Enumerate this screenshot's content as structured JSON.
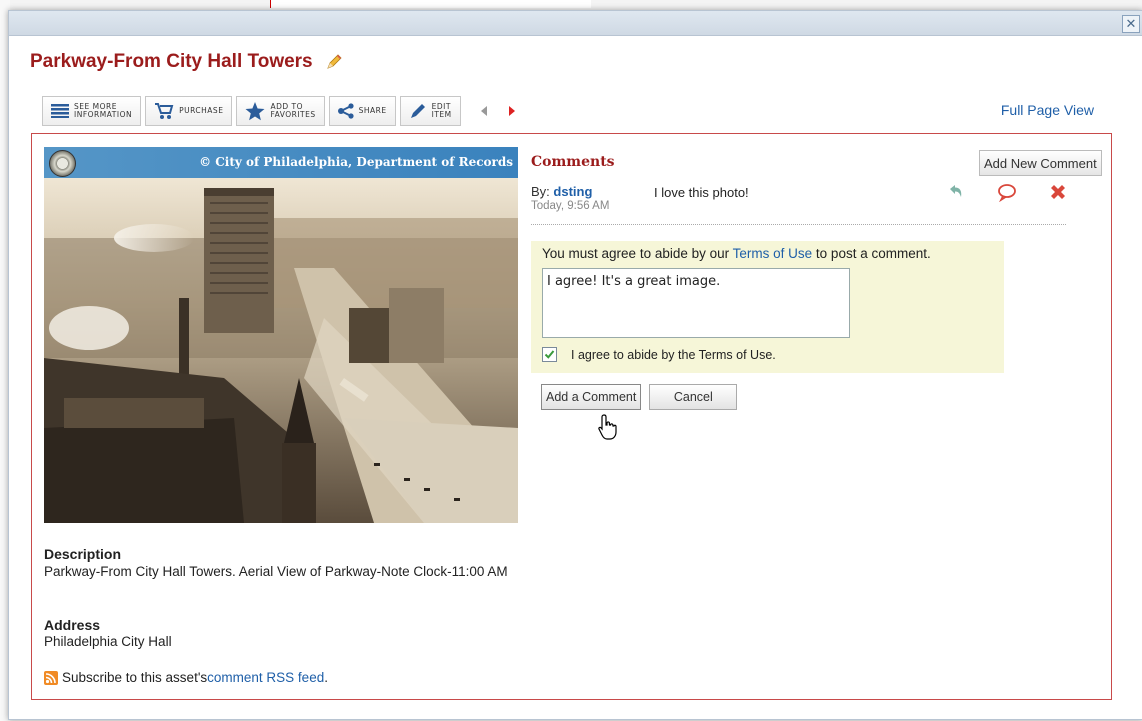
{
  "modal": {
    "close_glyph": "✕",
    "title": "Parkway-From City Hall Towers",
    "full_page_view": "Full Page View"
  },
  "toolbar": {
    "see_more": "SEE MORE\nINFORMATION",
    "purchase": "PURCHASE",
    "favorites": "ADD TO\nFAVORITES",
    "share": "SHARE",
    "edit": "EDIT\nITEM"
  },
  "photo": {
    "credit": "© City of Philadelphia, Department of Records"
  },
  "details": {
    "description_label": "Description",
    "description": "Parkway-From City Hall Towers. Aerial View of Parkway-Note Clock-11:00 AM",
    "address_label": "Address",
    "address": "Philadelphia City Hall",
    "rss_prefix": "Subscribe to this asset's ",
    "rss_link": "comment RSS feed",
    "rss_suffix": "."
  },
  "comments": {
    "title": "Comments",
    "add_new": "Add New Comment",
    "items": [
      {
        "by_label": "By: ",
        "user": "dsting",
        "time": "Today, 9:56 AM",
        "text": "I love this photo!"
      }
    ]
  },
  "form": {
    "terms_prefix": "You must agree to abide by our ",
    "terms_link": "Terms of Use",
    "terms_suffix": " to post a comment.",
    "comment_value": "I agree! It's a great image.",
    "agree_label": "I agree to abide by the Terms of Use.",
    "agree_checked": true,
    "add_button": "Add a Comment",
    "cancel_button": "Cancel"
  },
  "colors": {
    "title": "#9b1c1c",
    "link": "#1f5fa8",
    "content_border": "#c84a4a",
    "form_bg": "#f6f6d8",
    "banner": "#3a82bd"
  }
}
